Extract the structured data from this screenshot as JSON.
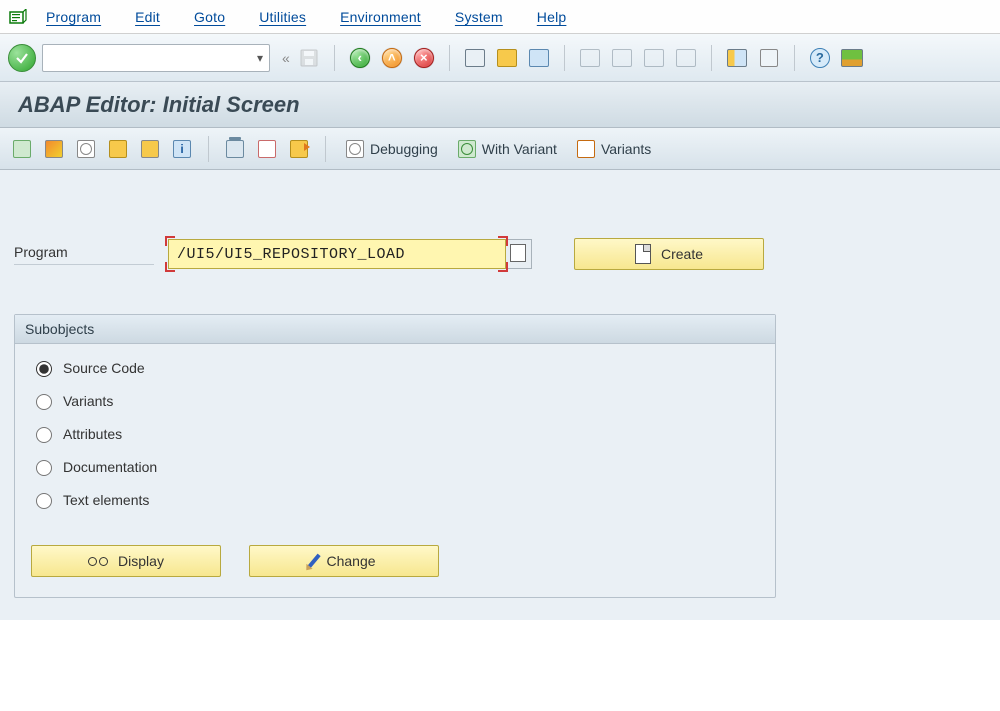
{
  "menu": {
    "items": [
      "Program",
      "Edit",
      "Goto",
      "Utilities",
      "Environment",
      "System",
      "Help"
    ]
  },
  "title": "ABAP Editor: Initial Screen",
  "app_toolbar": {
    "debugging": "Debugging",
    "with_variant": "With Variant",
    "variants": "Variants"
  },
  "program": {
    "label": "Program",
    "value": "/UI5/UI5_REPOSITORY_LOAD",
    "create": "Create"
  },
  "subobjects": {
    "title": "Subobjects",
    "options": {
      "source_code": "Source Code",
      "variants": "Variants",
      "attributes": "Attributes",
      "documentation": "Documentation",
      "text_elements": "Text elements"
    },
    "selected": "source_code",
    "display": "Display",
    "change": "Change"
  }
}
